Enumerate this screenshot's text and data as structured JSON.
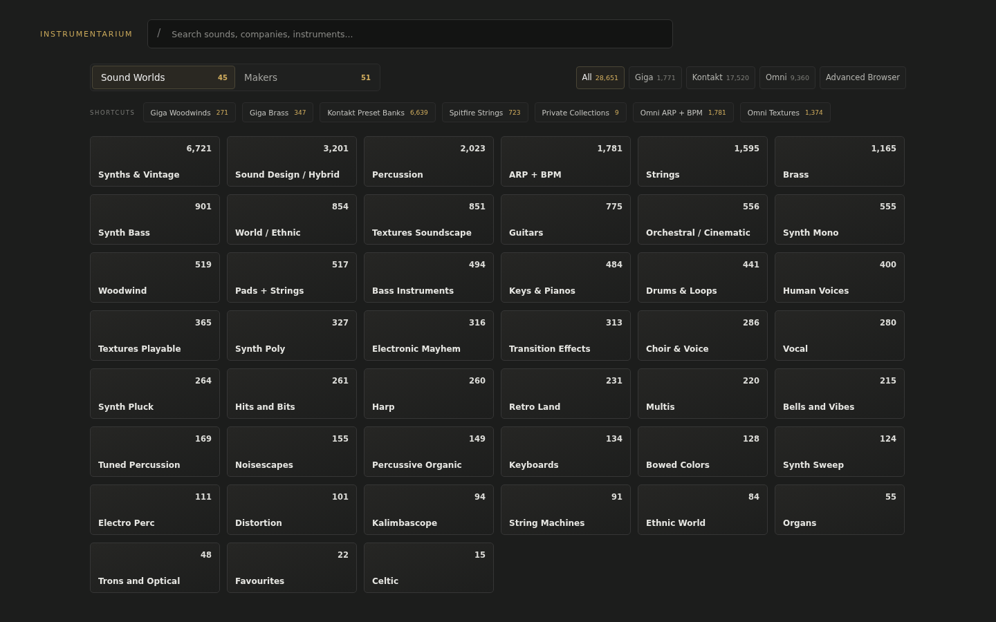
{
  "brand": "INSTRUMENTARIUM",
  "search": {
    "icon_char": "/",
    "placeholder": "Search sounds, companies, instruments..."
  },
  "view_tabs": [
    {
      "label": "Sound Worlds",
      "count": "45",
      "selected": true
    },
    {
      "label": "Makers",
      "count": "51",
      "selected": false
    }
  ],
  "filters": [
    {
      "label": "All",
      "count": "28,651",
      "selected": true
    },
    {
      "label": "Giga",
      "count": "1,771",
      "selected": false
    },
    {
      "label": "Kontakt",
      "count": "17,520",
      "selected": false
    },
    {
      "label": "Omni",
      "count": "9,360",
      "selected": false
    },
    {
      "label": "Advanced Browser",
      "selected": false
    }
  ],
  "shortcuts": {
    "label": "SHORTCUTS",
    "items": [
      {
        "label": "Giga Woodwinds",
        "count": "271"
      },
      {
        "label": "Giga Brass",
        "count": "347"
      },
      {
        "label": "Kontakt Preset Banks",
        "count": "6,639"
      },
      {
        "label": "Spitfire Strings",
        "count": "723"
      },
      {
        "label": "Private Collections",
        "count": "9"
      },
      {
        "label": "Omni ARP + BPM",
        "count": "1,781"
      },
      {
        "label": "Omni Textures",
        "count": "1,374"
      }
    ]
  },
  "categories": [
    {
      "name": "Synths & Vintage",
      "count": "6,721"
    },
    {
      "name": "Sound Design / Hybrid",
      "count": "3,201"
    },
    {
      "name": "Percussion",
      "count": "2,023"
    },
    {
      "name": "ARP + BPM",
      "count": "1,781"
    },
    {
      "name": "Strings",
      "count": "1,595"
    },
    {
      "name": "Brass",
      "count": "1,165"
    },
    {
      "name": "Synth Bass",
      "count": "901"
    },
    {
      "name": "World / Ethnic",
      "count": "854"
    },
    {
      "name": "Textures Soundscape",
      "count": "851"
    },
    {
      "name": "Guitars",
      "count": "775"
    },
    {
      "name": "Orchestral / Cinematic",
      "count": "556"
    },
    {
      "name": "Synth Mono",
      "count": "555"
    },
    {
      "name": "Woodwind",
      "count": "519"
    },
    {
      "name": "Pads + Strings",
      "count": "517"
    },
    {
      "name": "Bass Instruments",
      "count": "494"
    },
    {
      "name": "Keys & Pianos",
      "count": "484"
    },
    {
      "name": "Drums & Loops",
      "count": "441"
    },
    {
      "name": "Human Voices",
      "count": "400"
    },
    {
      "name": "Textures Playable",
      "count": "365"
    },
    {
      "name": "Synth Poly",
      "count": "327"
    },
    {
      "name": "Electronic Mayhem",
      "count": "316"
    },
    {
      "name": "Transition Effects",
      "count": "313"
    },
    {
      "name": "Choir & Voice",
      "count": "286"
    },
    {
      "name": "Vocal",
      "count": "280"
    },
    {
      "name": "Synth Pluck",
      "count": "264"
    },
    {
      "name": "Hits and Bits",
      "count": "261"
    },
    {
      "name": "Harp",
      "count": "260"
    },
    {
      "name": "Retro Land",
      "count": "231"
    },
    {
      "name": "Multis",
      "count": "220"
    },
    {
      "name": "Bells and Vibes",
      "count": "215"
    },
    {
      "name": "Tuned Percussion",
      "count": "169"
    },
    {
      "name": "Noisescapes",
      "count": "155"
    },
    {
      "name": "Percussive Organic",
      "count": "149"
    },
    {
      "name": "Keyboards",
      "count": "134"
    },
    {
      "name": "Bowed Colors",
      "count": "128"
    },
    {
      "name": "Synth Sweep",
      "count": "124"
    },
    {
      "name": "Electro Perc",
      "count": "111"
    },
    {
      "name": "Distortion",
      "count": "101"
    },
    {
      "name": "Kalimbascope",
      "count": "94"
    },
    {
      "name": "String Machines",
      "count": "91"
    },
    {
      "name": "Ethnic World",
      "count": "84"
    },
    {
      "name": "Organs",
      "count": "55"
    },
    {
      "name": "Trons and Optical",
      "count": "48"
    },
    {
      "name": "Favourites",
      "count": "22"
    },
    {
      "name": "Celtic",
      "count": "15"
    }
  ]
}
